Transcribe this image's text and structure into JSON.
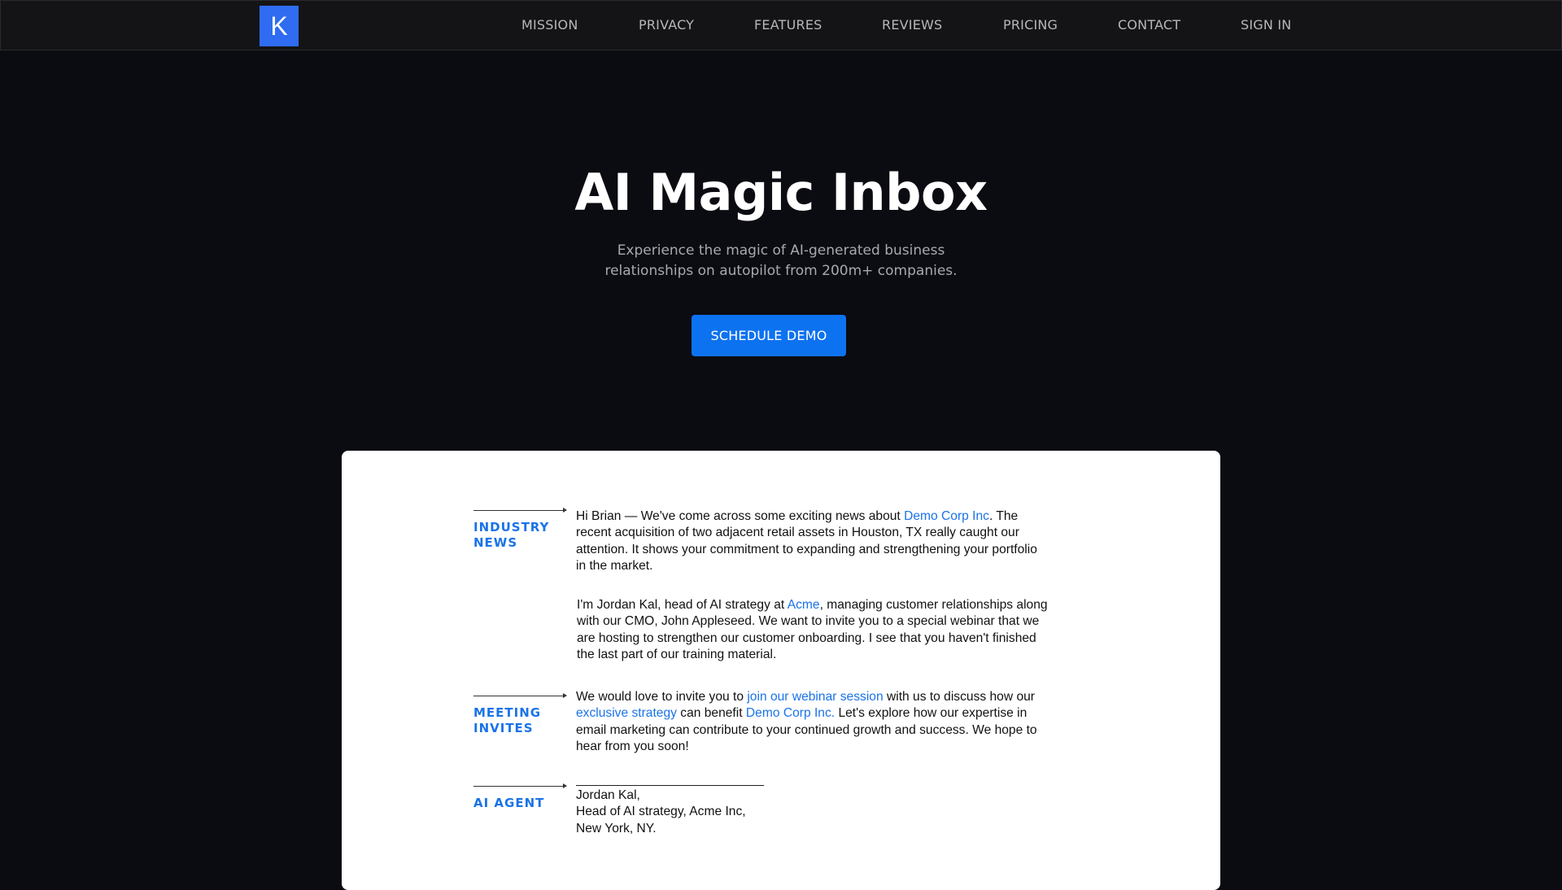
{
  "nav": {
    "logo_letter": "K",
    "items": [
      "MISSION",
      "PRIVACY",
      "FEATURES",
      "REVIEWS",
      "PRICING",
      "CONTACT",
      "SIGN IN"
    ]
  },
  "hero": {
    "title": "AI Magic Inbox",
    "subtitle_line1": "Experience the magic of AI-generated business",
    "subtitle_line2": "relationships on autopilot from 200m+ companies.",
    "cta_label": "SCHEDULE DEMO"
  },
  "email": {
    "tags": [
      "INDUSTRY NEWS",
      "MEETING INVITES",
      "AI AGENT"
    ],
    "p1": {
      "a": "Hi Brian — We've come across some exciting news about ",
      "link1": "Demo Corp Inc",
      "b": ". The recent acquisition of two adjacent retail assets in Houston, TX really caught our attention. It shows your commitment to expanding and strengthening your portfolio in the market."
    },
    "p2": {
      "a": "I'm Jordan Kal, head of AI strategy at ",
      "link1": "Acme",
      "b": ", managing customer relationships along with our CMO, John Appleseed. We want to invite you to a special webinar that we are hosting to strengthen our customer onboarding. I see that you haven't finished the last part of our training material."
    },
    "p3": {
      "a": "We would love to invite you to ",
      "link1": "join our webinar session",
      "b": " with us to discuss how our ",
      "link2": "exclusive strategy",
      "c": " can benefit ",
      "link3": "Demo Corp Inc.",
      "d": " Let's explore how our expertise in email marketing can contribute to your continued growth and success. We hope to hear from you soon!"
    },
    "signature": {
      "name": "Jordan Kal,",
      "title": "Head of AI strategy, Acme Inc,",
      "location": "New York, NY."
    }
  },
  "colors": {
    "background": "#0b0b12",
    "accent": "#0d72f0",
    "link": "#1a73e8",
    "logo": "#2f6cf2"
  }
}
